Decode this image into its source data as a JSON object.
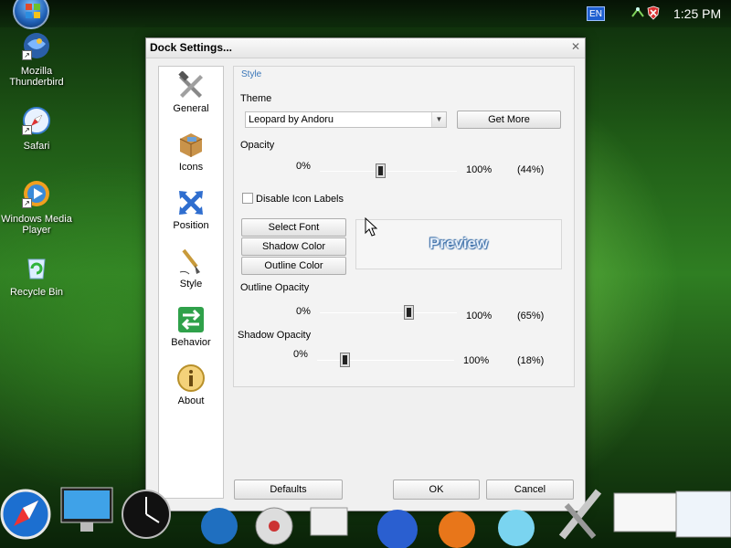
{
  "taskbar": {
    "language": "EN",
    "clock": "1:25 PM"
  },
  "desktop_icons": [
    {
      "label": "Mozilla\nThunderbird",
      "icon": "thunderbird-icon"
    },
    {
      "label": "Safari",
      "icon": "safari-icon"
    },
    {
      "label": "Windows Media\nPlayer",
      "icon": "media-player-icon"
    },
    {
      "label": "Recycle Bin",
      "icon": "recycle-bin-icon"
    }
  ],
  "dialog": {
    "title": "Dock Settings...",
    "nav": [
      {
        "label": "General",
        "icon": "hammer-wrench-icon"
      },
      {
        "label": "Icons",
        "icon": "box-icon"
      },
      {
        "label": "Position",
        "icon": "arrows-icon"
      },
      {
        "label": "Style",
        "icon": "brush-icon"
      },
      {
        "label": "Behavior",
        "icon": "arrows-swap-icon"
      },
      {
        "label": "About",
        "icon": "info-icon"
      }
    ],
    "style_group": "Style",
    "theme": {
      "label": "Theme",
      "selected": "Leopard by Andoru",
      "get_more": "Get More"
    },
    "opacity": {
      "label": "Opacity",
      "min": "0%",
      "max": "100%",
      "value": "(44%)"
    },
    "disable_labels": {
      "label": "Disable Icon Labels",
      "checked": false
    },
    "buttons": {
      "select_font": "Select Font",
      "shadow_color": "Shadow Color",
      "outline_color": "Outline Color"
    },
    "preview": "Preview",
    "outline_opacity": {
      "label": "Outline Opacity",
      "min": "0%",
      "max": "100%",
      "value": "(65%)"
    },
    "shadow_opacity": {
      "label": "Shadow Opacity",
      "min": "0%",
      "max": "100%",
      "value": "(18%)"
    },
    "footer": {
      "defaults": "Defaults",
      "ok": "OK",
      "cancel": "Cancel"
    }
  },
  "colors": {
    "accent": "#3a76b8",
    "dialog_bg": "#f0f0f0"
  }
}
